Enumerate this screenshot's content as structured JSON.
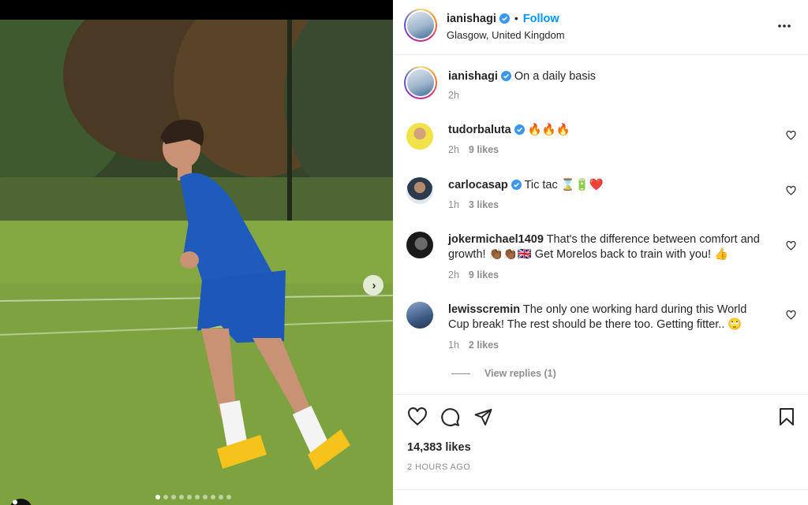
{
  "post": {
    "carousel": {
      "slide_count": 10,
      "active_slide": 1
    },
    "author": {
      "username": "ianishagi",
      "verified": true,
      "follow_label": "Follow",
      "location": "Glasgow, United Kingdom"
    },
    "caption": {
      "username": "ianishagi",
      "text": "On a daily basis",
      "time": "2h"
    },
    "comments": [
      {
        "username": "tudorbaluta",
        "verified": true,
        "text": "🔥🔥🔥",
        "time": "2h",
        "likes": "9 likes"
      },
      {
        "username": "carlocasap",
        "verified": true,
        "text": "Tic tac ⌛🔋❤️",
        "time": "1h",
        "likes": "3 likes"
      },
      {
        "username": "jokermichael1409",
        "verified": false,
        "text": "That's the difference between comfort and growth! 👏🏾👏🏾🇬🇧 Get Morelos back to train with you! 👍",
        "time": "2h",
        "likes": "9 likes"
      },
      {
        "username": "lewisscremin",
        "verified": false,
        "text": "The only one working hard during this World Cup break! The rest should be there too. Getting fitter.. 🙄",
        "time": "1h",
        "likes": "2 likes"
      }
    ],
    "view_replies_label": "View replies (1)",
    "likes_label": "14,383 likes",
    "time_ago": "2 HOURS AGO",
    "colors": {
      "link": "#0095f6",
      "muted": "#8e8e8e",
      "text": "#262626",
      "verified": "#3897f0"
    }
  }
}
